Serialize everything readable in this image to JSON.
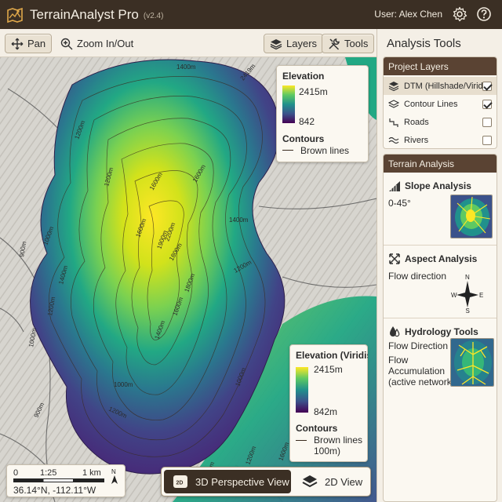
{
  "app": {
    "title": "TerrainAnalyst Pro",
    "version": "(v2.4)",
    "user": "User: Alex Chen"
  },
  "toolbar": {
    "pan": "Pan",
    "zoom": "Zoom In/Out",
    "layers": "Layers",
    "tools": "Tools"
  },
  "map": {
    "contour_labels": [
      "1000m",
      "1200m",
      "1400m",
      "1200m",
      "1600m",
      "1900m",
      "2200m",
      "1800m",
      "1600m",
      "1400m",
      "1200m",
      "1000m",
      "900m",
      "900m",
      "1000m",
      "1200m",
      "1400m",
      "1600m",
      "1800m",
      "1600m",
      "1400m",
      "1200m",
      "1000m",
      "2419m",
      "1200m",
      "1400m",
      "1600m"
    ],
    "legend_top": {
      "title": "Elevation",
      "max": "2415m",
      "min": "842",
      "contours_title": "Contours",
      "contours_desc": "Brown lines"
    },
    "legend_bottom": {
      "title": "Elevation (Viridis",
      "max": "2415m",
      "min": "842m",
      "contours_title": "Contours",
      "contours_line1": "Brown lines",
      "contours_line2": "100m)"
    },
    "scale": {
      "zero": "0",
      "ratio": "1:25",
      "distance": "1 km",
      "north": "N",
      "coords": "36.14°N, -112.11°W"
    },
    "views": {
      "view3d": "3D Perspective View",
      "view2d": "2D View",
      "view3d_badge": "2D"
    }
  },
  "panel": {
    "title": "Analysis Tools",
    "layers_title": "Project Layers",
    "layers": [
      {
        "name": "DTM (Hillshade/Viridis",
        "checked": true,
        "icon": "layers-icon"
      },
      {
        "name": "Contour Lines",
        "checked": true,
        "icon": "contour-icon"
      },
      {
        "name": "Roads",
        "checked": false,
        "icon": "road-icon"
      },
      {
        "name": "Rivers",
        "checked": false,
        "icon": "river-icon"
      }
    ],
    "analysis_title": "Terrain Analysis",
    "slope": {
      "title": "Slope Analysis",
      "range": "0-45°"
    },
    "aspect": {
      "title": "Aspect Analysis",
      "desc": "Flow direction",
      "n": "N",
      "s": "S",
      "e": "E",
      "w": "W"
    },
    "hydrology": {
      "title": "Hydrology Tools",
      "line1": "Flow Direction",
      "line2": "Flow",
      "line3": "Accumulation",
      "line4": "(active network"
    }
  },
  "colors": {
    "titlebar": "#3b2f24",
    "section_header": "#5a4333",
    "viridis_high": "#fde725",
    "viridis_low": "#440154"
  }
}
